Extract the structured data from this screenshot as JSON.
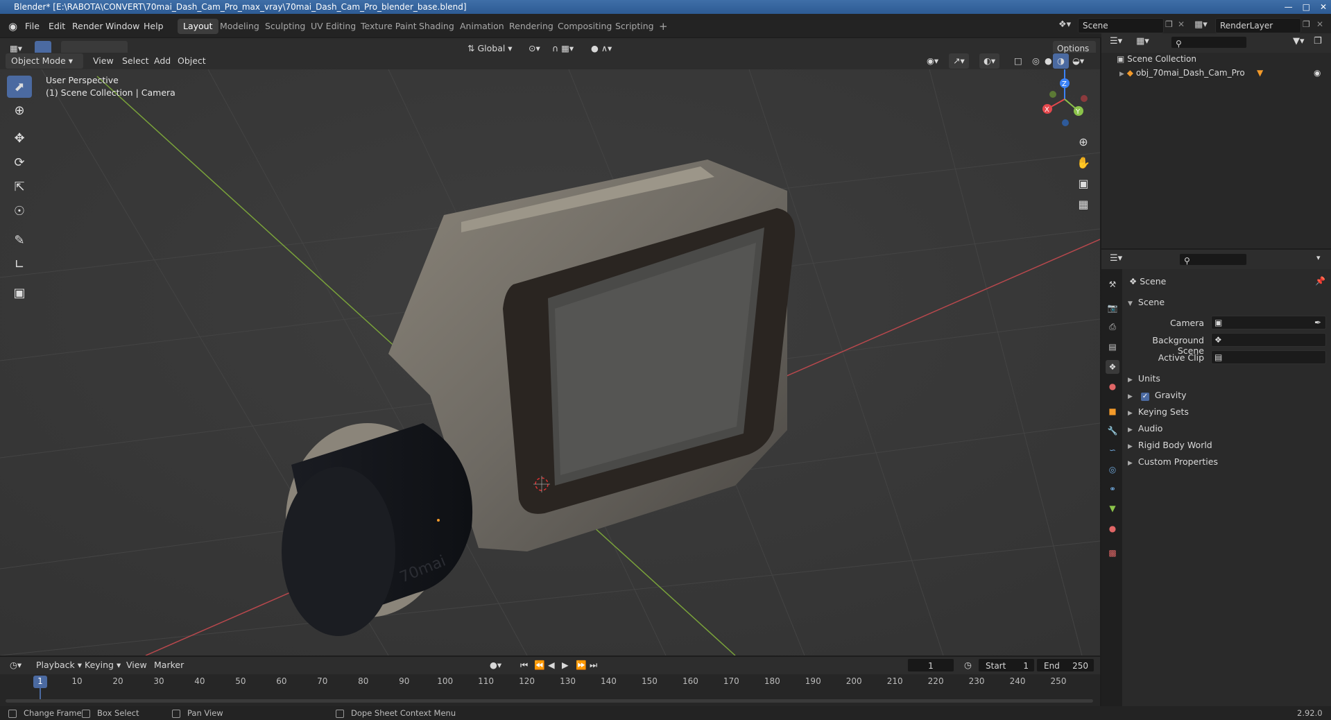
{
  "window": {
    "title": "Blender* [E:\\RABOTA\\CONVERT\\70mai_Dash_Cam_Pro_max_vray\\70mai_Dash_Cam_Pro_blender_base.blend]"
  },
  "menu": {
    "items": [
      "File",
      "Edit",
      "Render",
      "Window",
      "Help"
    ]
  },
  "workspaces": [
    "Layout",
    "Modeling",
    "Sculpting",
    "UV Editing",
    "Texture Paint",
    "Shading",
    "Animation",
    "Rendering",
    "Compositing",
    "Scripting"
  ],
  "scene": {
    "name": "Scene",
    "render_layer": "RenderLayer"
  },
  "viewport_header": {
    "mode": "Object Mode",
    "items": [
      "View",
      "Select",
      "Add",
      "Object"
    ],
    "orientation": "Global",
    "options": "Options"
  },
  "viewport": {
    "perspective": "User Perspective",
    "collection_info": "(1) Scene Collection | Camera",
    "axes": {
      "x": "X",
      "y": "Y",
      "z": "Z"
    },
    "model_brand": "70mai"
  },
  "outliner": {
    "root": "Scene Collection",
    "object": "obj_70mai_Dash_Cam_Pro"
  },
  "properties": {
    "context": "Scene",
    "panel": "Scene",
    "fields": {
      "camera": "Camera",
      "background_scene": "Background Scene",
      "active_clip": "Active Clip"
    },
    "sections": [
      "Units",
      "Gravity",
      "Keying Sets",
      "Audio",
      "Rigid Body World",
      "Custom Properties"
    ],
    "gravity_checked": true
  },
  "timeline": {
    "menus": [
      "Playback",
      "Keying",
      "View",
      "Marker"
    ],
    "current_frame": "1",
    "start_label": "Start",
    "start": "1",
    "end_label": "End",
    "end": "250",
    "ticks": [
      "1",
      "10",
      "20",
      "30",
      "40",
      "50",
      "60",
      "70",
      "80",
      "90",
      "100",
      "110",
      "120",
      "130",
      "140",
      "150",
      "160",
      "170",
      "180",
      "190",
      "200",
      "210",
      "220",
      "230",
      "240",
      "250"
    ]
  },
  "statusbar": {
    "change_frame": "Change Frame",
    "box_select": "Box Select",
    "pan_view": "Pan View",
    "context_menu": "Dope Sheet Context Menu",
    "version": "2.92.0"
  },
  "colors": {
    "accent": "#4b6aa1",
    "axis_x": "#e5484d",
    "axis_y": "#8bc34a",
    "axis_z": "#3b82f6"
  }
}
